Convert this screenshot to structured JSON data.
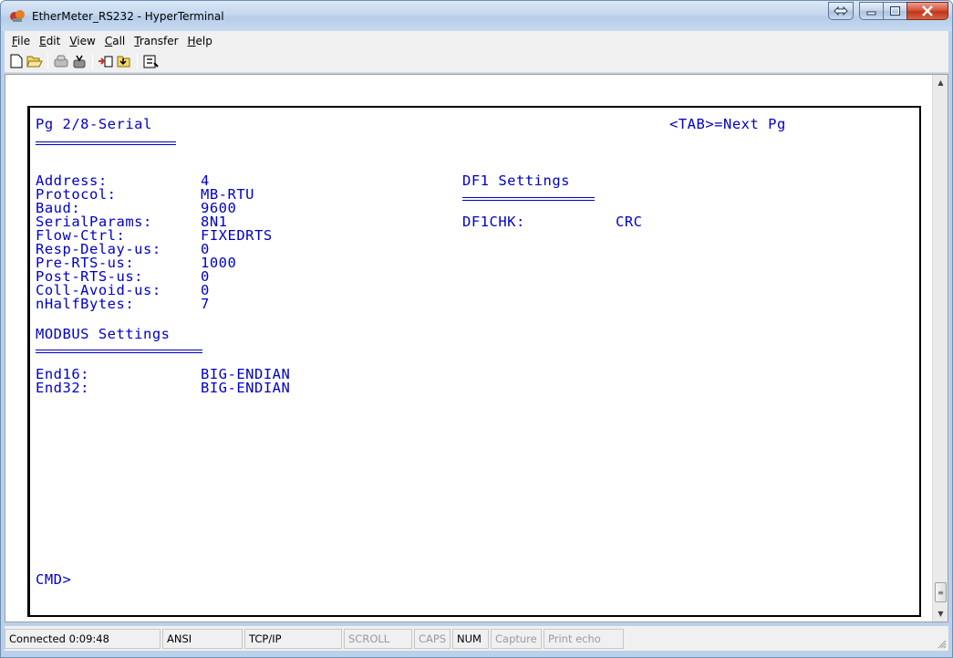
{
  "window": {
    "title": "EtherMeter_RS232 - HyperTerminal"
  },
  "menu": [
    {
      "u": "F",
      "rest": "ile"
    },
    {
      "u": "E",
      "rest": "dit"
    },
    {
      "u": "V",
      "rest": "iew"
    },
    {
      "u": "C",
      "rest": "all"
    },
    {
      "u": "T",
      "rest": "ransfer"
    },
    {
      "u": "H",
      "rest": "elp"
    }
  ],
  "toolbar": {
    "icons": [
      "new-icon",
      "open-icon",
      "disconnect-icon",
      "dial-icon",
      "send-icon",
      "receive-icon",
      "properties-icon"
    ]
  },
  "terminal": {
    "page_title": "Pg 2/8-Serial",
    "nav_hint": "<TAB>=Next Pg",
    "serial_fields": [
      {
        "label": "Address:",
        "value": "4"
      },
      {
        "label": "Protocol:",
        "value": "MB-RTU"
      },
      {
        "label": "Baud:",
        "value": "9600"
      },
      {
        "label": "SerialParams:",
        "value": "8N1"
      },
      {
        "label": "Flow-Ctrl:",
        "value": "FIXEDRTS"
      },
      {
        "label": "Resp-Delay-us:",
        "value": "0"
      },
      {
        "label": "Pre-RTS-us:",
        "value": "1000"
      },
      {
        "label": "Post-RTS-us:",
        "value": "0"
      },
      {
        "label": "Coll-Avoid-us:",
        "value": "0"
      },
      {
        "label": "nHalfBytes:",
        "value": "7"
      }
    ],
    "df1_heading": "DF1 Settings",
    "df1_fields": [
      {
        "label": "DF1CHK:",
        "value": "CRC"
      }
    ],
    "modbus_heading": "MODBUS Settings",
    "modbus_fields": [
      {
        "label": "End16:",
        "value": "BIG-ENDIAN"
      },
      {
        "label": "End32:",
        "value": "BIG-ENDIAN"
      }
    ],
    "prompt": "CMD>"
  },
  "statusbar": {
    "connected": "Connected 0:09:48",
    "emulation": "ANSI",
    "port": "TCP/IP",
    "scroll": "SCROLL",
    "caps": "CAPS",
    "num": "NUM",
    "capture": "Capture",
    "print_echo": "Print echo"
  },
  "colors": {
    "terminal_text": "#0000c8",
    "titlebar": "#c3d7ee",
    "close_button": "#c23417"
  }
}
